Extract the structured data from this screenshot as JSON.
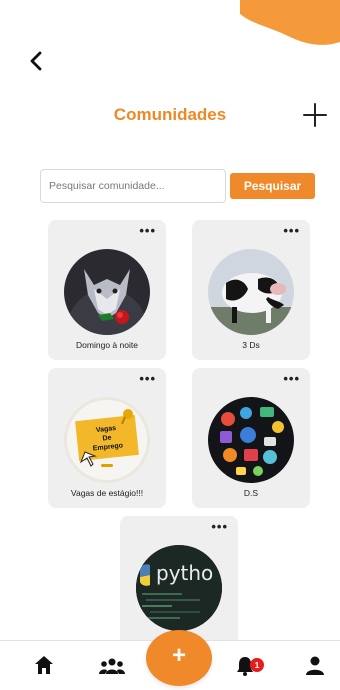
{
  "header": {
    "title": "Comunidades",
    "back_icon": "chevron-left-icon",
    "add_icon": "plus-icon"
  },
  "search": {
    "placeholder": "Pesquisar comunidade...",
    "value": "",
    "button_label": "Pesquisar"
  },
  "colors": {
    "accent": "#f0892a",
    "card_bg": "#efefef",
    "badge": "#e51d1d"
  },
  "communities": [
    {
      "name": "Domingo à noite",
      "image": "wolf-with-rose"
    },
    {
      "name": "3 Ds",
      "image": "cow"
    },
    {
      "name": "Vagas de estágio!!!",
      "image": "vagas-de-emprego-note",
      "image_text": [
        "Vagas",
        "De",
        "Emprego"
      ]
    },
    {
      "name": "D.S",
      "image": "tech-stickers"
    },
    {
      "name": "",
      "image": "python-code",
      "image_text": "pytho"
    }
  ],
  "more_label": "•••",
  "bottom_nav": {
    "items": [
      {
        "name": "home-icon"
      },
      {
        "name": "communities-icon"
      },
      {
        "name": "add-icon",
        "label": "+"
      },
      {
        "name": "notifications-icon",
        "badge": "1"
      },
      {
        "name": "profile-icon"
      }
    ]
  }
}
